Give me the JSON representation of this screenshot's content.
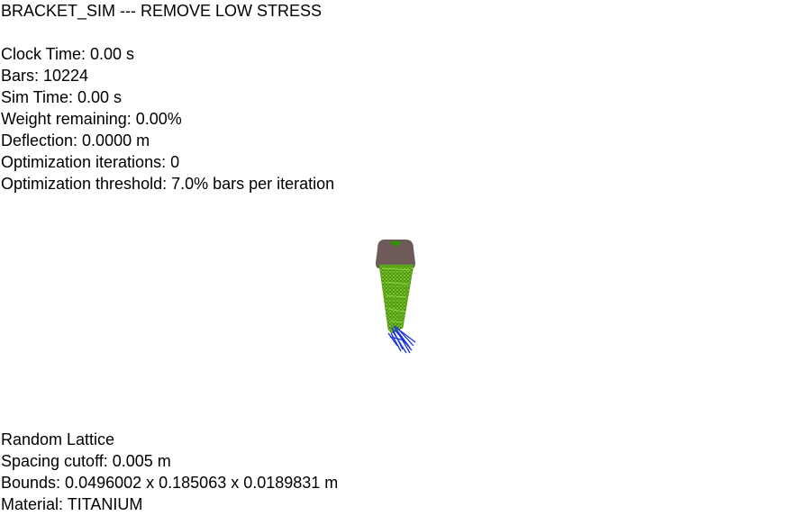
{
  "window": {
    "title": "BRACKET_SIM --- REMOVE LOW STRESS"
  },
  "stats": {
    "clock_time": "Clock Time: 0.00 s",
    "bars": "Bars: 10224",
    "sim_time": "Sim Time: 0.00 s",
    "weight_remaining": "Weight remaining: 0.00%",
    "deflection": "Deflection: 0.0000 m",
    "optimization_iterations": "Optimization iterations: 0",
    "optimization_threshold": "Optimization threshold: 7.0% bars per iteration"
  },
  "info": {
    "lattice_type": "Random Lattice",
    "spacing_cutoff": "Spacing cutoff: 0.005 m",
    "bounds": "Bounds: 0.0496002 x 0.185063 x 0.0189831 m",
    "material": "Material: TITANIUM"
  },
  "colors": {
    "background": "#ffffff",
    "fixed_mount": "#6e5a58",
    "lattice": "#5aa812",
    "load_bars": "#1a32e0"
  },
  "viewport": {
    "object": "bracket-lattice-mesh"
  }
}
